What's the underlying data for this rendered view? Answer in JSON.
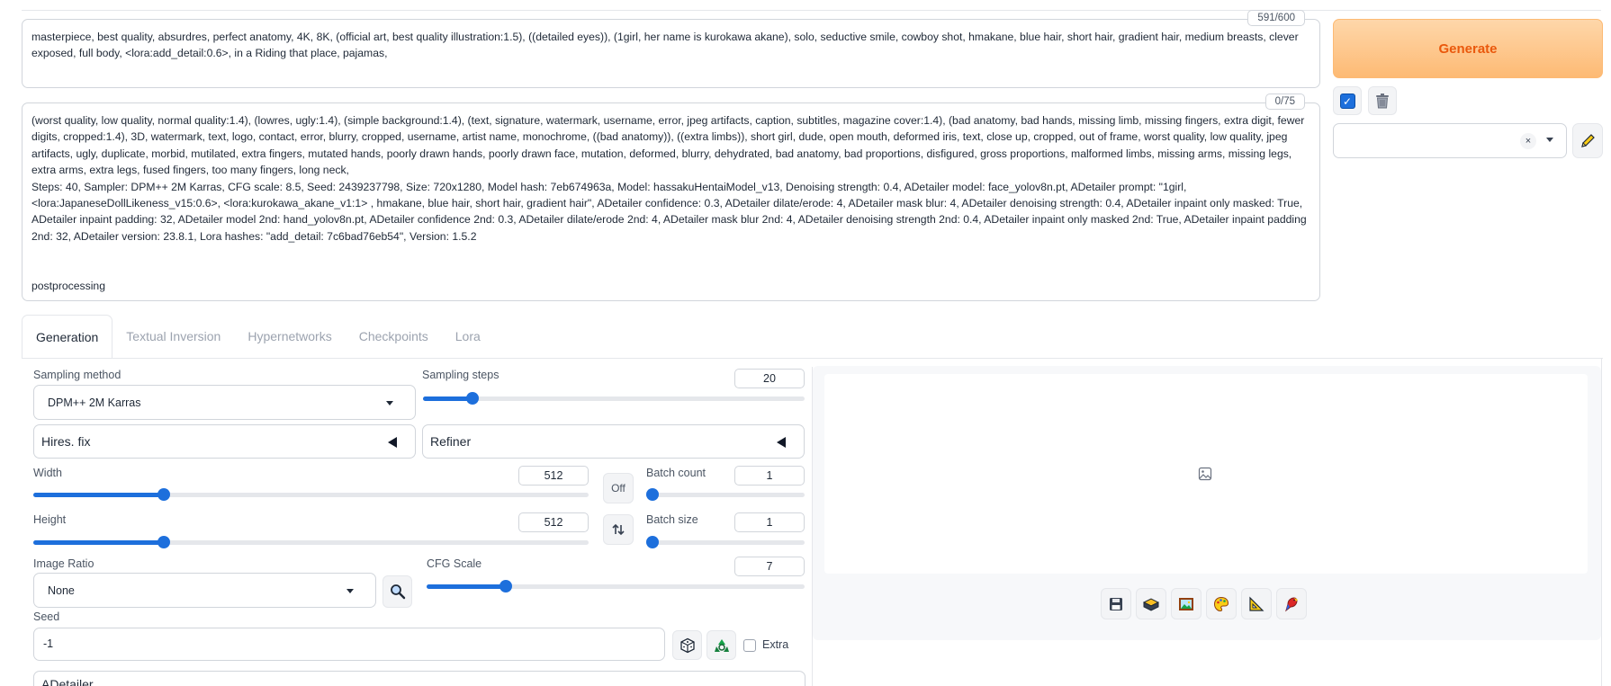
{
  "prompt": {
    "positive_text": "masterpiece, best quality, absurdres, perfect anatomy, 4K, 8K, (official art, best quality illustration:1.5), ((detailed eyes)), (1girl, her name is kurokawa akane), solo, seductive smile, cowboy shot, hmakane, blue hair, short hair, gradient hair, medium breasts, clever exposed, full body, <lora:add_detail:0.6>, in a Riding that place, pajamas,",
    "positive_count": "591/600",
    "negative_text": "(worst quality, low quality, normal quality:1.4), (lowres, ugly:1.4), (simple background:1.4), (text, signature, watermark, username, error, jpeg artifacts, caption, subtitles, magazine cover:1.4), (bad anatomy, bad hands, missing limb, missing fingers, extra digit, fewer digits, cropped:1.4), 3D, watermark, text, logo, contact, error, blurry, cropped, username, artist name, monochrome, ((bad anatomy)), ((extra limbs)), short girl, dude, open mouth, deformed iris, text, close up, cropped, out of frame, worst quality, low quality, jpeg artifacts, ugly, duplicate, morbid, mutilated, extra fingers, mutated hands, poorly drawn hands, poorly drawn face, mutation, deformed, blurry, dehydrated, bad anatomy, bad proportions, disfigured, gross proportions, malformed limbs, missing arms, missing legs, extra arms, extra legs, fused fingers, too many fingers, long neck,\nSteps: 40, Sampler: DPM++ 2M Karras, CFG scale: 8.5, Seed: 2439237798, Size: 720x1280, Model hash: 7eb674963a, Model: hassakuHentaiModel_v13, Denoising strength: 0.4, ADetailer model: face_yolov8n.pt, ADetailer prompt: \"1girl, <lora:JapaneseDollLikeness_v15:0.6>, <lora:kurokawa_akane_v1:1> , hmakane, blue hair, short hair, gradient hair\", ADetailer confidence: 0.3, ADetailer dilate/erode: 4, ADetailer mask blur: 4, ADetailer denoising strength: 0.4, ADetailer inpaint only masked: True, ADetailer inpaint padding: 32, ADetailer model 2nd: hand_yolov8n.pt, ADetailer confidence 2nd: 0.3, ADetailer dilate/erode 2nd: 4, ADetailer mask blur 2nd: 4, ADetailer denoising strength 2nd: 0.4, ADetailer inpaint only masked 2nd: True, ADetailer inpaint padding 2nd: 32, ADetailer version: 23.8.1, Lora hashes: \"add_detail: 7c6bad76eb54\", Version: 1.5.2\n\n\npostprocessing",
    "negative_count": "0/75"
  },
  "actions": {
    "generate_label": "Generate",
    "styles_value": ""
  },
  "tabs": [
    {
      "label": "Generation"
    },
    {
      "label": "Textual Inversion"
    },
    {
      "label": "Hypernetworks"
    },
    {
      "label": "Checkpoints"
    },
    {
      "label": "Lora"
    }
  ],
  "generation": {
    "sampling_method_label": "Sampling method",
    "sampling_method_value": "DPM++ 2M Karras",
    "sampling_steps_label": "Sampling steps",
    "sampling_steps_value": "20",
    "sampling_steps_fraction": 0.13,
    "hires_label": "Hires. fix",
    "refiner_label": "Refiner",
    "width_label": "Width",
    "width_value": "512",
    "width_fraction": 0.235,
    "height_label": "Height",
    "height_value": "512",
    "height_fraction": 0.235,
    "off_label": "Off",
    "batch_count_label": "Batch count",
    "batch_count_value": "1",
    "batch_size_label": "Batch size",
    "batch_size_value": "1",
    "image_ratio_label": "Image Ratio",
    "image_ratio_value": "None",
    "cfg_label": "CFG Scale",
    "cfg_value": "7",
    "cfg_fraction": 0.21,
    "seed_label": "Seed",
    "seed_value": "-1",
    "extra_label": "Extra",
    "adetailer_label": "ADetailer"
  }
}
